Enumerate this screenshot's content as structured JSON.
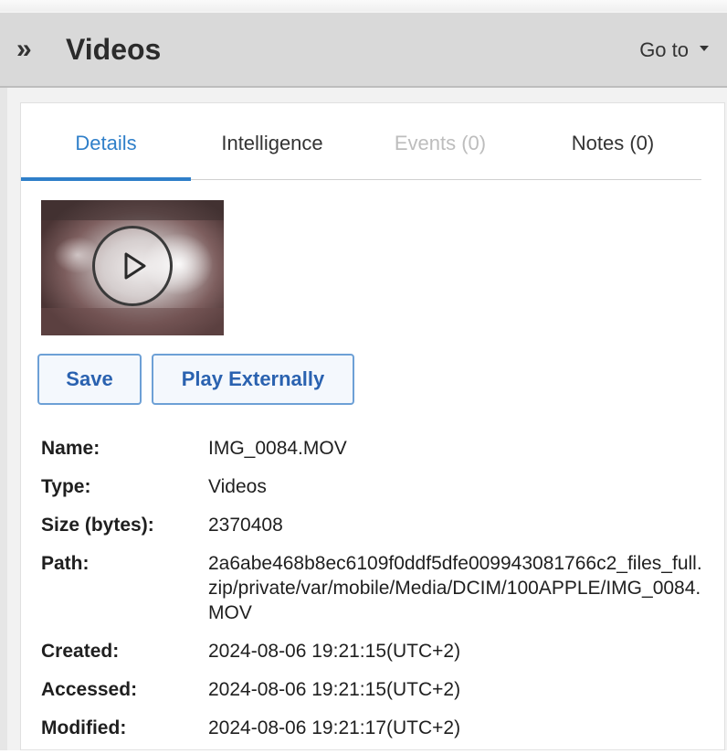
{
  "header": {
    "title": "Videos",
    "goto_label": "Go to"
  },
  "tabs": [
    {
      "label": "Details",
      "state": "active"
    },
    {
      "label": "Intelligence",
      "state": "normal"
    },
    {
      "label": "Events (0)",
      "state": "disabled"
    },
    {
      "label": "Notes (0)",
      "state": "normal"
    }
  ],
  "buttons": {
    "save": "Save",
    "play_externally": "Play Externally"
  },
  "details": [
    {
      "label": "Name:",
      "value": "IMG_0084.MOV"
    },
    {
      "label": "Type:",
      "value": "Videos"
    },
    {
      "label": "Size (bytes):",
      "value": "2370408"
    },
    {
      "label": "Path:",
      "value": "2a6abe468b8ec6109f0ddf5dfe009943081766c2_files_full.zip/private/var/mobile/Media/DCIM/100APPLE/IMG_0084.MOV"
    },
    {
      "label": "Created:",
      "value": "2024-08-06 19:21:15(UTC+2)"
    },
    {
      "label": "Accessed:",
      "value": "2024-08-06 19:21:15(UTC+2)"
    },
    {
      "label": "Modified:",
      "value": "2024-08-06 19:21:17(UTC+2)"
    }
  ],
  "colors": {
    "accent": "#2f7fc9",
    "button_text": "#2a62b0",
    "header_bg": "#d9d9d9"
  }
}
